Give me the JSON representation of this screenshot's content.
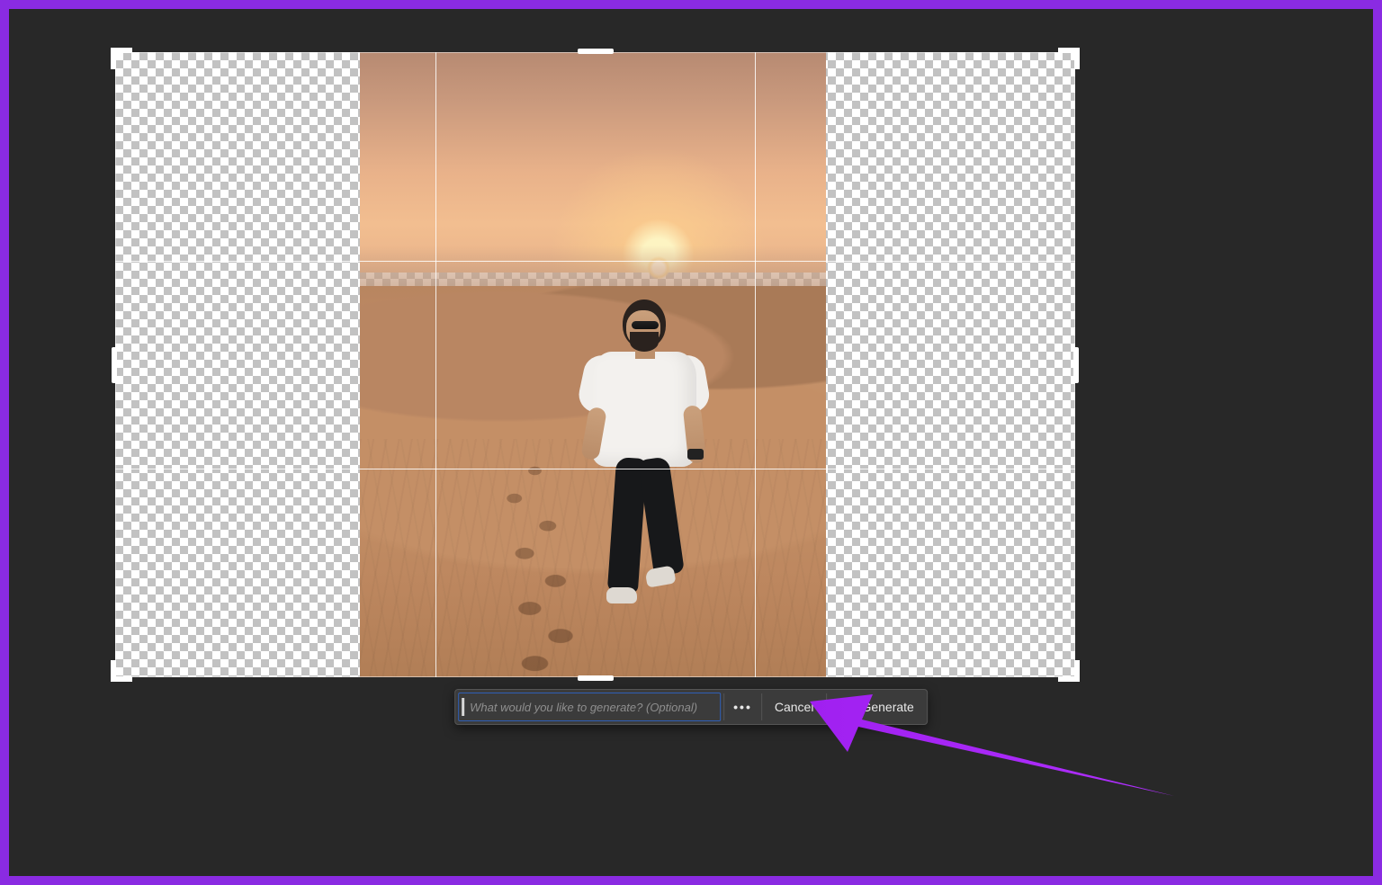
{
  "toolbar": {
    "prompt_placeholder": "What would you like to generate? (Optional)",
    "more_label": "More options",
    "cancel_label": "Cancel",
    "generate_label": "Generate"
  },
  "canvas": {
    "crop_handle_names": [
      "top-left",
      "top-right",
      "bottom-left",
      "bottom-right",
      "top",
      "bottom",
      "left",
      "right"
    ]
  },
  "annotation": {
    "arrow_color": "#a020f0"
  }
}
